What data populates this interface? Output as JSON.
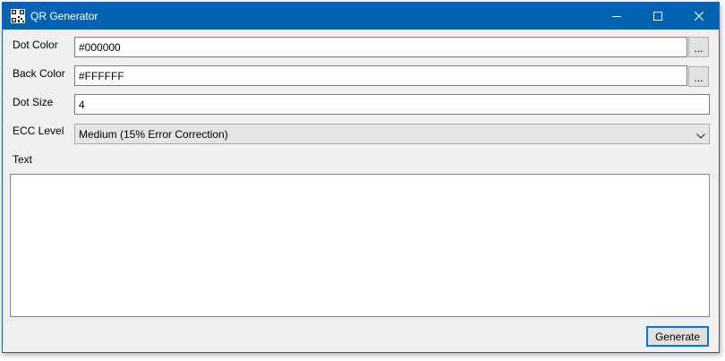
{
  "window": {
    "title": "QR Generator",
    "controls": {
      "minimize": "minimize-icon",
      "maximize": "maximize-icon",
      "close": "close-icon"
    }
  },
  "form": {
    "dot_color": {
      "label": "Dot Color",
      "value": "#000000",
      "picker_label": "..."
    },
    "back_color": {
      "label": "Back Color",
      "value": "#FFFFFF",
      "picker_label": "..."
    },
    "dot_size": {
      "label": "Dot Size",
      "value": "4"
    },
    "ecc_level": {
      "label": "ECC Level",
      "selected": "Medium (15% Error Correction)"
    },
    "text": {
      "label": "Text",
      "value": ""
    }
  },
  "actions": {
    "generate_label": "Generate"
  },
  "colors": {
    "titlebar": "#0063b1",
    "focus_border": "#0078d7",
    "window_bg": "#f0f0f0"
  }
}
